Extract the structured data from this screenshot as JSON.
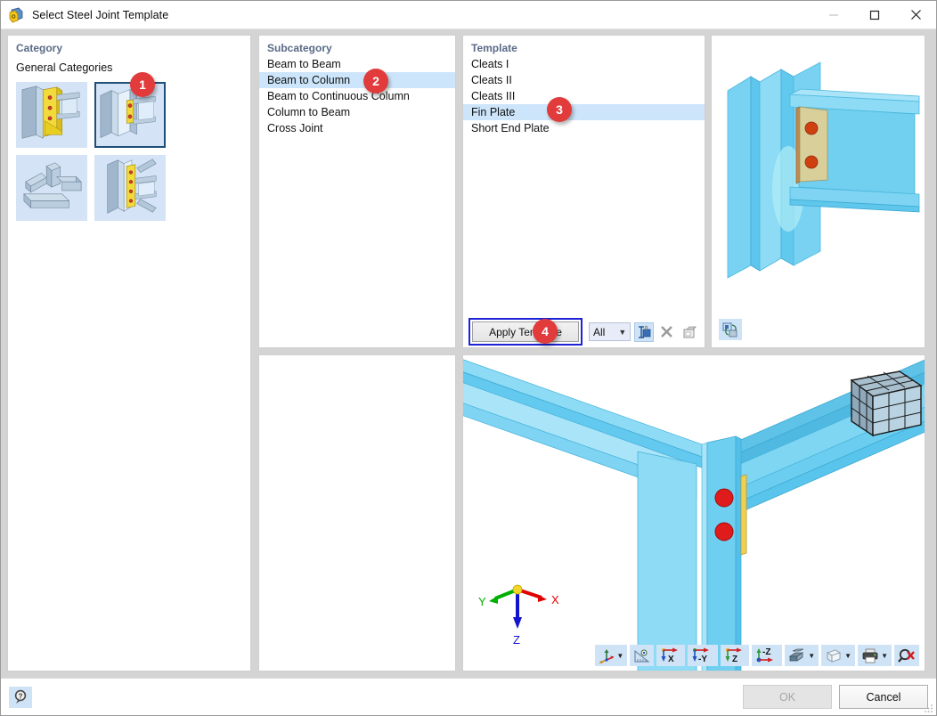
{
  "window": {
    "title": "Select Steel Joint Template",
    "icon": "steel-joint-icon",
    "controls": {
      "minimize": "minimize-icon",
      "maximize": "maximize-icon",
      "close": "close-icon"
    }
  },
  "category": {
    "title": "Category",
    "subtitle": "General Categories",
    "thumbnails": [
      {
        "name": "haunched-moment-connection",
        "selected": false
      },
      {
        "name": "beam-to-column-fin-plate",
        "selected": true
      },
      {
        "name": "hollow-section-cross-joint",
        "selected": false
      },
      {
        "name": "braced-column-connection",
        "selected": false
      }
    ]
  },
  "subcategory": {
    "title": "Subcategory",
    "items": [
      {
        "label": "Beam to Beam",
        "selected": false
      },
      {
        "label": "Beam to Column",
        "selected": true
      },
      {
        "label": "Beam to Continuous Column",
        "selected": false
      },
      {
        "label": "Column to Beam",
        "selected": false
      },
      {
        "label": "Cross Joint",
        "selected": false
      }
    ]
  },
  "template": {
    "title": "Template",
    "items": [
      {
        "label": "Cleats I",
        "selected": false
      },
      {
        "label": "Cleats II",
        "selected": false
      },
      {
        "label": "Cleats III",
        "selected": false
      },
      {
        "label": "Fin Plate",
        "selected": true
      },
      {
        "label": "Short End Plate",
        "selected": false
      }
    ],
    "footer": {
      "apply_label": "Apply Template",
      "filter_value": "All",
      "icons": [
        {
          "name": "edit-template-icon",
          "state": "active"
        },
        {
          "name": "delete-template-icon",
          "state": "disabled"
        },
        {
          "name": "save-template-icon",
          "state": "disabled"
        },
        {
          "name": "refresh-preview-icon",
          "state": "active"
        }
      ]
    }
  },
  "preview": {
    "name": "joint-preview-3d",
    "refresh_button": "refresh-view-icon",
    "description": "Fin plate beam to column connection"
  },
  "viewport": {
    "name": "model-viewport-3d",
    "axes": {
      "x": "X",
      "y": "Y",
      "z": "Z"
    },
    "axis_colors": {
      "x": "#e00000",
      "y": "#00b000",
      "z": "#1414cd"
    },
    "nav_cube": "navigation-cube",
    "toolbar": [
      {
        "name": "coordinate-system-icon",
        "has_dropdown": true
      },
      {
        "name": "view-angle-icon",
        "has_dropdown": false
      },
      {
        "name": "view-direction-x-icon",
        "label": "X",
        "has_dropdown": false
      },
      {
        "name": "view-direction-minus-y-icon",
        "label": "-Y",
        "has_dropdown": false
      },
      {
        "name": "view-direction-z-icon",
        "label": "Z",
        "has_dropdown": false
      },
      {
        "name": "view-direction-minus-z-icon",
        "label": "-Z",
        "has_dropdown": false
      },
      {
        "name": "render-mode-icon",
        "has_dropdown": true
      },
      {
        "name": "wireframe-mode-icon",
        "has_dropdown": true
      },
      {
        "name": "print-icon",
        "has_dropdown": true
      },
      {
        "name": "zoom-reset-icon",
        "has_dropdown": false
      }
    ]
  },
  "lower_left_panel": {
    "name": "details-panel",
    "content": ""
  },
  "footer": {
    "help_icon": "help-icon",
    "ok_label": "OK",
    "ok_disabled": true,
    "cancel_label": "Cancel"
  },
  "badges": [
    {
      "number": "1",
      "target": "category-panel"
    },
    {
      "number": "2",
      "target": "subcategory-panel"
    },
    {
      "number": "3",
      "target": "template-panel"
    },
    {
      "number": "4",
      "target": "apply-template-button"
    }
  ],
  "colors": {
    "selection_blue": "#cce5fa",
    "badge_red": "#e23b3b",
    "highlight_border": "#1d22d8",
    "steel_cyan": "#5ecdf0",
    "plate_beige": "#d8cf9a",
    "bolt_red": "#e01b1b",
    "panel_title": "#5a6b87"
  }
}
